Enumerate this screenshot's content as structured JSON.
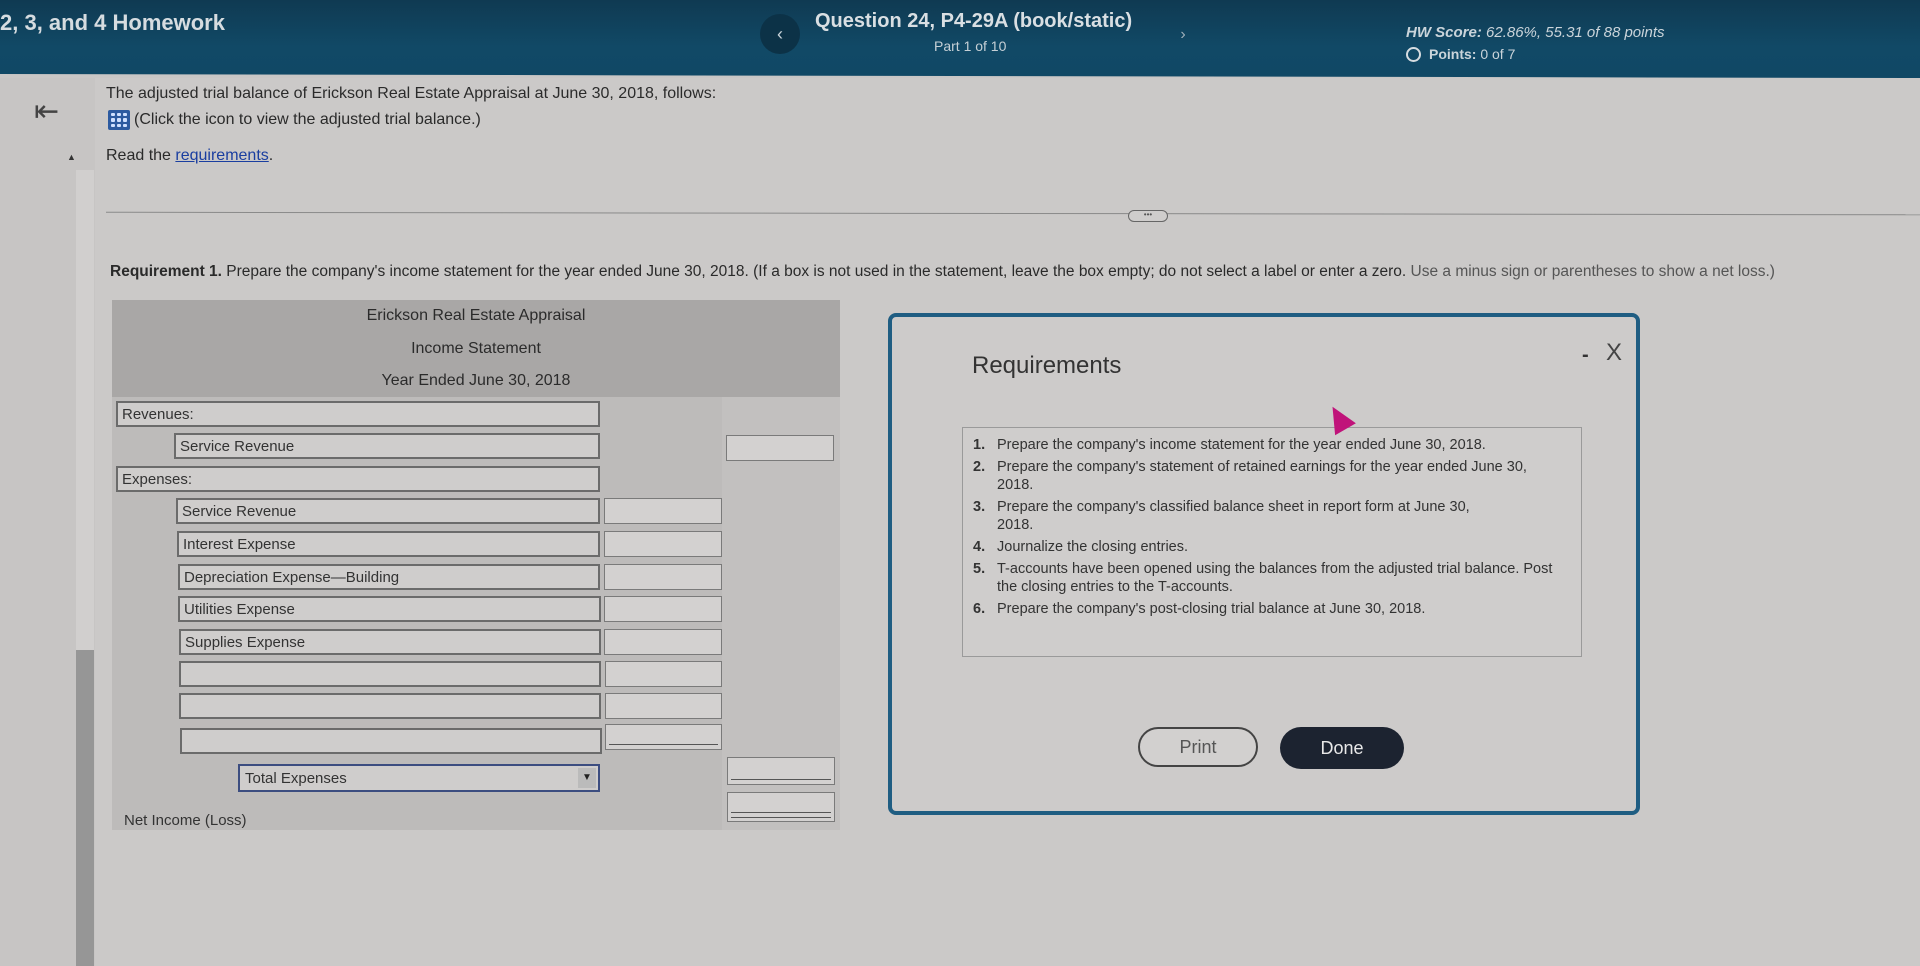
{
  "header": {
    "assignment_title": "2, 3, and 4 Homework",
    "question_title": "Question 24, P4-29A (book/static)",
    "part": "Part 1 of 10",
    "hw_score_label": "HW Score:",
    "hw_score_value": "62.86%, 55.31 of 88 points",
    "points_label": "Points:",
    "points_value": "0 of 7",
    "prev_icon": "chevron-left-icon",
    "next_icon": "chevron-right-icon"
  },
  "intro": {
    "text": "The adjusted trial balance of Erickson Real Estate Appraisal at June 30, 2018, follows:",
    "trial_balance_link": "(Click the icon to view the adjusted trial balance.)",
    "read_prefix": "Read the ",
    "read_link": "requirements",
    "read_suffix": "."
  },
  "requirement1": {
    "label": "Requirement 1.",
    "text": " Prepare the company's income statement for the year ended June 30, 2018. (If a box is not used in the statement, leave the box empty; do not select a label or enter a zero. ",
    "faint": "Use a minus sign or parentheses to show a net loss.)"
  },
  "statement": {
    "company": "Erickson Real Estate Appraisal",
    "title": "Income Statement",
    "period": "Year Ended June 30, 2018",
    "revenues_label": "Revenues:",
    "revenue_items": [
      "Service Revenue"
    ],
    "expenses_label": "Expenses:",
    "expense_items": [
      "Service Revenue",
      "Interest Expense",
      "Depreciation Expense—Building",
      "Utilities Expense",
      "Supplies Expense",
      "",
      "",
      ""
    ],
    "total_select": "Total Expenses",
    "net_income_label": "Net Income (Loss)"
  },
  "modal": {
    "title": "Requirements",
    "minimize": "-",
    "close": "X",
    "items": [
      {
        "num": "1.",
        "text": "Prepare the company's income statement for the year ended June 30, 2018."
      },
      {
        "num": "2.",
        "text": "Prepare the company's statement of retained earnings for the year ended June 30, 2018."
      },
      {
        "num": "3.",
        "text": "Prepare the company's classified balance sheet in report form at June 30, 2018."
      },
      {
        "num": "4.",
        "text": "Journalize the closing entries."
      },
      {
        "num": "5.",
        "text": "T-accounts have been opened using the balances from the adjusted trial balance. Post the closing entries to the T-accounts."
      },
      {
        "num": "6.",
        "text": "Prepare the company's post-closing trial balance at June 30, 2018."
      }
    ],
    "print_label": "Print",
    "done_label": "Done"
  },
  "colors": {
    "header_bg": "#114966",
    "modal_border": "#1f5d82",
    "done_bg": "#1c2330",
    "link": "#1a3ea0",
    "cursor": "#c0137a"
  }
}
